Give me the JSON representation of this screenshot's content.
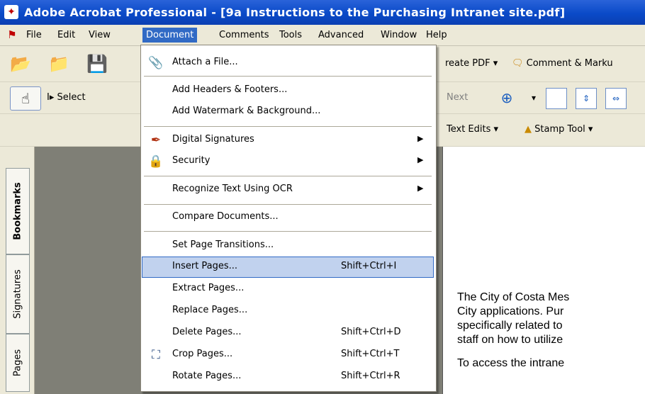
{
  "window": {
    "title": "Adobe Acrobat Professional - [9a Instructions to the Purchasing Intranet site.pdf]"
  },
  "menubar": {
    "items": [
      "File",
      "Edit",
      "View",
      "Document",
      "Comments",
      "Tools",
      "Advanced",
      "Window",
      "Help"
    ]
  },
  "toolbar": {
    "create_pdf": "reate PDF",
    "comment_markup": "Comment & Marku",
    "select": "Select",
    "next": "Next",
    "text_edits": "Text Edits",
    "stamp_tool": "Stamp Tool"
  },
  "side_tabs": [
    "Bookmarks",
    "Signatures",
    "Pages"
  ],
  "document_menu": {
    "attach": "Attach a File...",
    "headers_footers": "Add Headers & Footers...",
    "watermark": "Add Watermark & Background...",
    "digital_signatures": "Digital Signatures",
    "security": "Security",
    "ocr": "Recognize Text Using OCR",
    "compare": "Compare Documents...",
    "transitions": "Set Page Transitions...",
    "insert": "Insert Pages...",
    "insert_sc": "Shift+Ctrl+I",
    "extract": "Extract Pages...",
    "replace": "Replace Pages...",
    "delete": "Delete Pages...",
    "delete_sc": "Shift+Ctrl+D",
    "crop": "Crop Pages...",
    "crop_sc": "Shift+Ctrl+T",
    "rotate": "Rotate Pages...",
    "rotate_sc": "Shift+Ctrl+R"
  },
  "document_body": [
    "The City of Costa Mes",
    "City applications.  Pur",
    "specifically related to",
    "staff on how to utilize",
    "To access the intrane"
  ],
  "colors": {
    "titlebar": "#0a4ac8",
    "menu_highlight": "#316ac5",
    "item_highlight": "#c1d2ee"
  }
}
